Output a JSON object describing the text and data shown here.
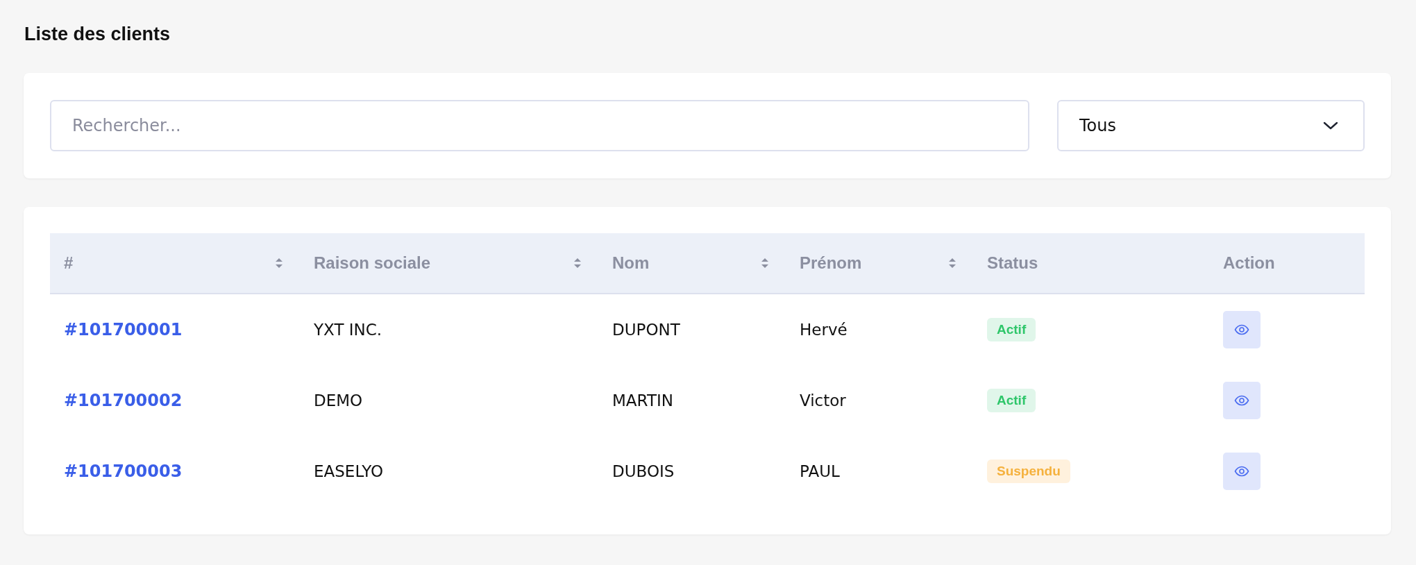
{
  "page_title": "Liste des clients",
  "filters": {
    "search": {
      "placeholder": "Rechercher..."
    },
    "status_select": {
      "value": "Tous"
    }
  },
  "table": {
    "columns": [
      {
        "label": "#",
        "sortable": true
      },
      {
        "label": "Raison sociale",
        "sortable": true
      },
      {
        "label": "Nom",
        "sortable": true
      },
      {
        "label": "Prénom",
        "sortable": true
      },
      {
        "label": "Status",
        "sortable": false
      },
      {
        "label": "Action",
        "sortable": false
      }
    ],
    "rows": [
      {
        "id": "#101700001",
        "company": "YXT INC.",
        "last_name": "DUPONT",
        "first_name": "Hervé",
        "status": {
          "label": "Actif",
          "kind": "active"
        }
      },
      {
        "id": "#101700002",
        "company": "DEMO",
        "last_name": "MARTIN",
        "first_name": "Victor",
        "status": {
          "label": "Actif",
          "kind": "active"
        }
      },
      {
        "id": "#101700003",
        "company": "EASELYO",
        "last_name": "DUBOIS",
        "first_name": "PAUL",
        "status": {
          "label": "Suspendu",
          "kind": "suspended"
        }
      }
    ]
  }
}
